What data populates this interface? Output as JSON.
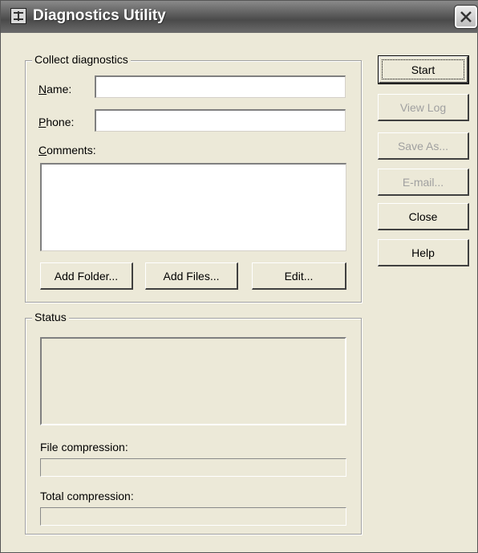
{
  "window": {
    "title": "Diagnostics Utility"
  },
  "collect": {
    "legend": "Collect diagnostics",
    "name_label": "Name:",
    "name_value": "",
    "phone_label": "Phone:",
    "phone_value": "",
    "comments_label": "Comments:",
    "comments_value": "",
    "add_folder_label": "Add Folder...",
    "add_files_label": "Add Files...",
    "edit_label": "Edit..."
  },
  "status": {
    "legend": "Status",
    "file_compression_label": "File compression:",
    "file_compression_progress": 0,
    "total_compression_label": "Total compression:",
    "total_compression_progress": 0
  },
  "buttons": {
    "start": "Start",
    "view_log": "View Log",
    "save_as": "Save As...",
    "email": "E-mail...",
    "close": "Close",
    "help": "Help"
  },
  "icons": {
    "app": "diagnostics-app-icon",
    "close": "close-x-icon"
  }
}
